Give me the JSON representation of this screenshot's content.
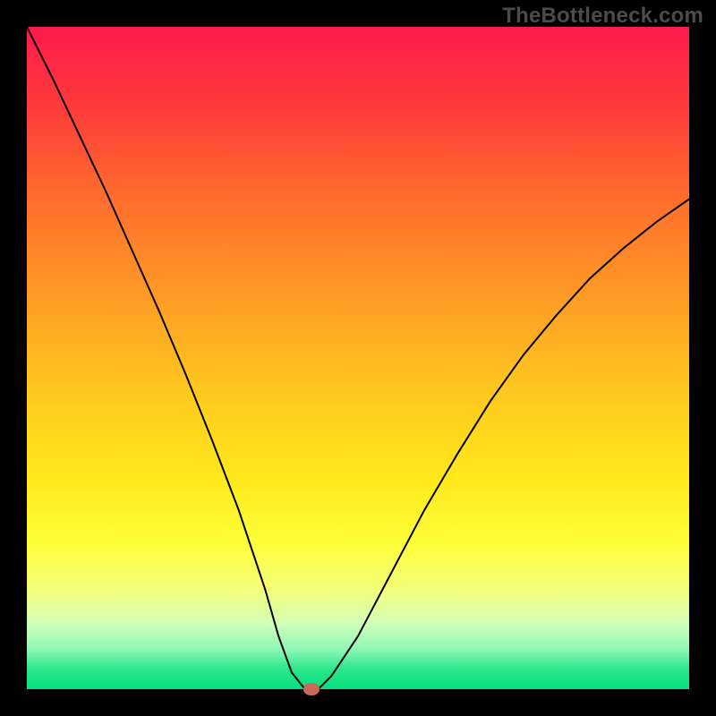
{
  "watermark": "TheBottleneck.com",
  "chart_data": {
    "type": "line",
    "title": "",
    "xlabel": "",
    "ylabel": "",
    "xlim": [
      0,
      100
    ],
    "ylim": [
      0,
      100
    ],
    "grid": false,
    "legend": false,
    "series": [
      {
        "name": "bottleneck-curve",
        "x": [
          0,
          4,
          8,
          12,
          16,
          20,
          24,
          28,
          32,
          36,
          38,
          40,
          42,
          44,
          46,
          50,
          55,
          60,
          65,
          70,
          75,
          80,
          85,
          90,
          95,
          100
        ],
        "y": [
          100,
          92,
          83.5,
          75,
          66,
          57,
          47.5,
          37.5,
          27,
          15,
          8,
          2.5,
          0,
          0,
          2,
          8,
          17.5,
          27,
          35.5,
          43.5,
          50.5,
          56.5,
          62,
          66.5,
          70.5,
          74
        ],
        "color": "#000000",
        "linewidth": 2
      }
    ],
    "marker": {
      "x": 43,
      "y": 0,
      "color": "#c86a57"
    },
    "gradient_stops": [
      {
        "pos": 0,
        "color": "#ff1a4d"
      },
      {
        "pos": 12,
        "color": "#ff3b3b"
      },
      {
        "pos": 25,
        "color": "#ff6a2d"
      },
      {
        "pos": 40,
        "color": "#ff9926"
      },
      {
        "pos": 55,
        "color": "#ffc81f"
      },
      {
        "pos": 68,
        "color": "#ffe81a"
      },
      {
        "pos": 78,
        "color": "#fdff3a"
      },
      {
        "pos": 85,
        "color": "#f4ff7a"
      },
      {
        "pos": 90,
        "color": "#d3ffb8"
      },
      {
        "pos": 94,
        "color": "#8ef7b6"
      },
      {
        "pos": 97,
        "color": "#2be68e"
      },
      {
        "pos": 100,
        "color": "#05e07d"
      }
    ]
  }
}
